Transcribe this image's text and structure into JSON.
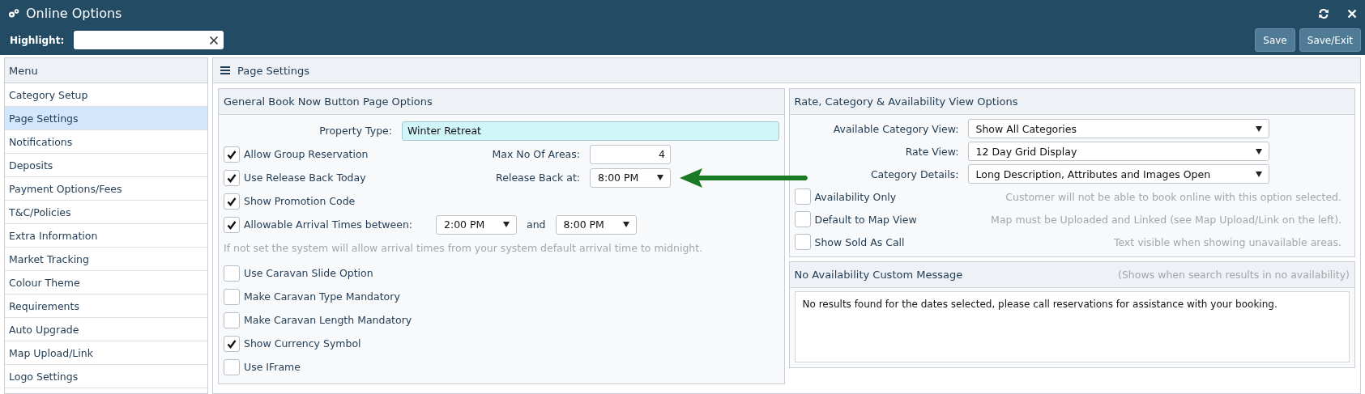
{
  "window": {
    "title": "Online Options"
  },
  "highlight": {
    "label": "Highlight:"
  },
  "header_buttons": [
    "Save",
    "Save/Exit"
  ],
  "menu": {
    "title": "Menu",
    "items": [
      {
        "label": "Category Setup",
        "selected": false
      },
      {
        "label": "Page Settings",
        "selected": true
      },
      {
        "label": "Notifications",
        "selected": false
      },
      {
        "label": "Deposits",
        "selected": false
      },
      {
        "label": "Payment Options/Fees",
        "selected": false
      },
      {
        "label": "T&C/Policies",
        "selected": false
      },
      {
        "label": "Extra Information",
        "selected": false
      },
      {
        "label": "Market Tracking",
        "selected": false
      },
      {
        "label": "Colour Theme",
        "selected": false
      },
      {
        "label": "Requirements",
        "selected": false
      },
      {
        "label": "Auto Upgrade",
        "selected": false
      },
      {
        "label": "Map Upload/Link",
        "selected": false
      },
      {
        "label": "Logo Settings",
        "selected": false
      }
    ]
  },
  "page": {
    "title": "Page Settings"
  },
  "general": {
    "title": "General Book Now Button Page Options",
    "rows": [
      {
        "kind": "field",
        "label": "Property Type:",
        "value": "Winter Retreat"
      },
      {
        "kind": "check",
        "label": "Allow Group Reservation",
        "checked": true,
        "side": {
          "kind": "number",
          "label": "Max No Of Areas:",
          "value": "4"
        }
      },
      {
        "kind": "check",
        "label": "Use Release Back Today",
        "checked": true,
        "side": {
          "kind": "select",
          "label": "Release Back at:",
          "value": "8:00 PM",
          "pointer": true
        }
      },
      {
        "kind": "check",
        "label": "Show Promotion Code",
        "checked": true
      },
      {
        "kind": "range",
        "label": "Allowable Arrival Times between:",
        "checked": true,
        "from": "2:00 PM",
        "joiner": "and",
        "to": "8:00 PM"
      },
      {
        "kind": "note",
        "text": "If not set the system will allow arrival times from your system default arrival time to midnight."
      },
      {
        "kind": "check",
        "label": "Use Caravan Slide Option",
        "checked": false
      },
      {
        "kind": "check",
        "label": "Make Caravan Type Mandatory",
        "checked": false
      },
      {
        "kind": "check",
        "label": "Make Caravan Length Mandatory",
        "checked": false
      },
      {
        "kind": "check",
        "label": "Show Currency Symbol",
        "checked": true
      },
      {
        "kind": "check",
        "label": "Use IFrame",
        "checked": false
      }
    ]
  },
  "view_options": {
    "title": "Rate, Category & Availability View Options",
    "selects": [
      {
        "label": "Available Category View:",
        "value": "Show All Categories"
      },
      {
        "label": "Rate View:",
        "value": "12 Day Grid Display"
      },
      {
        "label": "Category Details:",
        "value": "Long Description, Attributes and Images Open"
      }
    ],
    "options": [
      {
        "label": "Availability Only",
        "checked": false,
        "hint": "Customer will not be able to book online with this option selected."
      },
      {
        "label": "Default to Map View",
        "checked": false,
        "hint": "Map must be Uploaded and Linked (see Map Upload/Link on the left)."
      },
      {
        "label": "Show Sold As Call",
        "checked": false,
        "hint": "Text visible when showing unavailable areas."
      }
    ]
  },
  "no_availability": {
    "title": "No Availability Custom Message",
    "hint": "(Shows when search results in no availability)",
    "message": "No results found for the dates selected, please call reservations for assistance with your booking."
  }
}
